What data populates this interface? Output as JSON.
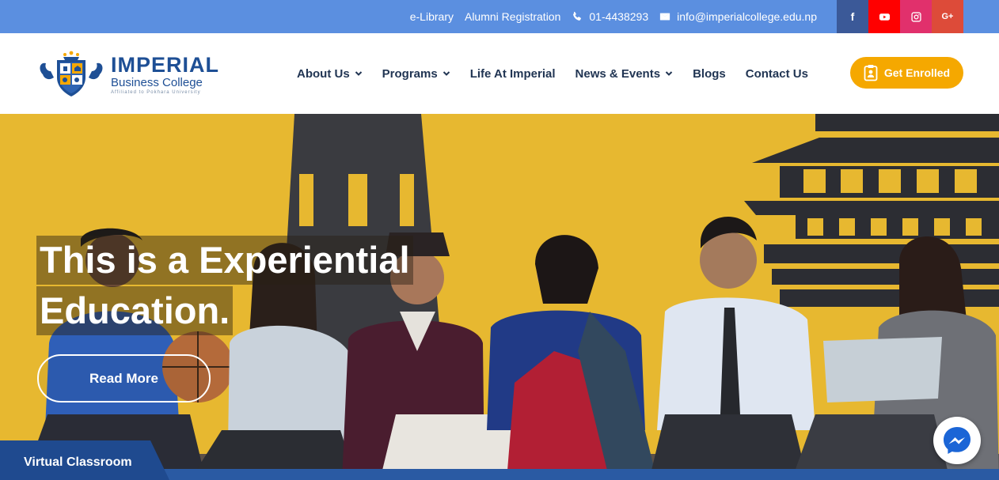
{
  "topbar": {
    "links": [
      {
        "label": "e-Library"
      },
      {
        "label": "Alumni Registration"
      },
      {
        "label": "01-4438293",
        "icon": "phone-icon"
      },
      {
        "label": "info@imperialcollege.edu.np",
        "icon": "envelope-icon"
      }
    ],
    "social": [
      {
        "name": "facebook-icon",
        "glyph": "f",
        "color": "#3b5998"
      },
      {
        "name": "youtube-icon",
        "color": "#ff0000"
      },
      {
        "name": "instagram-icon",
        "color": "#e1306c"
      },
      {
        "name": "google-plus-icon",
        "glyph": "G+",
        "color": "#dd4b39"
      }
    ]
  },
  "brand": {
    "name": "IMPERIAL",
    "subtitle": "Business College",
    "tagline": "Affiliated to Pokhara University"
  },
  "nav": [
    {
      "label": "About Us",
      "dropdown": true
    },
    {
      "label": "Programs",
      "dropdown": true
    },
    {
      "label": "Life At Imperial",
      "dropdown": false
    },
    {
      "label": "News & Events",
      "dropdown": true
    },
    {
      "label": "Blogs",
      "dropdown": false
    },
    {
      "label": "Contact Us",
      "dropdown": false
    }
  ],
  "cta": {
    "label": "Get Enrolled",
    "icon": "clipboard-user-icon"
  },
  "hero": {
    "headline_line1": "This is a Experiential",
    "headline_line2": "Education.",
    "button": "Read More"
  },
  "footer_tab": {
    "label": "Virtual Classroom"
  },
  "colors": {
    "topbar": "#5b8fe0",
    "nav_text": "#213553",
    "brand": "#1e4f95",
    "cta": "#f5a800",
    "hero_wall": "#e7b830",
    "tab": "#1f4a8f"
  }
}
